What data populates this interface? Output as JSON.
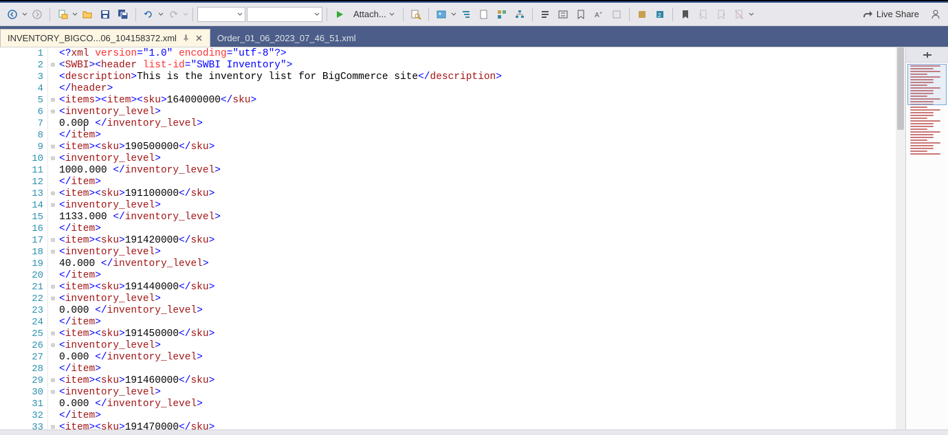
{
  "toolbar": {
    "attach_label": "Attach...",
    "liveshare_label": "Live Share"
  },
  "tabs": [
    {
      "label": "INVENTORY_BIGCO...06_104158372.xml",
      "active": true
    },
    {
      "label": "Order_01_06_2023_07_46_51.xml",
      "active": false
    }
  ],
  "code_lines": [
    {
      "n": 1,
      "fold": "",
      "html": "<span class='t-punc'>&lt;?</span><span class='t-tag'>xml</span> <span class='t-attr'>version</span><span class='t-punc'>=</span><span class='t-str'>\"1.0\"</span> <span class='t-attr'>encoding</span><span class='t-punc'>=</span><span class='t-str'>\"utf-8\"</span><span class='t-punc'>?&gt;</span>"
    },
    {
      "n": 2,
      "fold": "⊟",
      "html": "<span class='t-punc'>&lt;</span><span class='t-tag'>SWBI</span><span class='t-punc'>&gt;&lt;</span><span class='t-tag'>header</span> <span class='t-attr'>list-id</span><span class='t-punc'>=</span><span class='t-str'>\"SWBI Inventory\"</span><span class='t-punc'>&gt;</span>"
    },
    {
      "n": 3,
      "fold": "",
      "html": "<span class='t-punc'>&lt;</span><span class='t-tag'>description</span><span class='t-punc'>&gt;</span><span class='t-text'>This is the inventory list for BigCommerce site</span><span class='t-punc'>&lt;/</span><span class='t-tag'>description</span><span class='t-punc'>&gt;</span>"
    },
    {
      "n": 4,
      "fold": "",
      "html": "<span class='t-punc'>&lt;/</span><span class='t-tag'>header</span><span class='t-punc'>&gt;</span>"
    },
    {
      "n": 5,
      "fold": "⊟",
      "html": "<span class='t-punc'>&lt;</span><span class='t-tag'>items</span><span class='t-punc'>&gt;&lt;</span><span class='t-tag'>item</span><span class='t-punc'>&gt;&lt;</span><span class='t-tag'>sku</span><span class='t-punc'>&gt;</span><span class='t-text'>164000000</span><span class='t-punc'>&lt;/</span><span class='t-tag'>sku</span><span class='t-punc'>&gt;</span>"
    },
    {
      "n": 6,
      "fold": "⊟",
      "html": "<span class='t-punc'>&lt;</span><span class='t-tag'>inventory_level</span><span class='t-punc'>&gt;</span>"
    },
    {
      "n": 7,
      "fold": "",
      "html": "<span class='t-text'>0.000 </span><span class='t-punc'>&lt;/</span><span class='t-tag'>inventory_level</span><span class='t-punc'>&gt;</span>"
    },
    {
      "n": 8,
      "fold": "",
      "html": "<span class='t-punc'>&lt;/</span><span class='t-tag'>item</span><span class='t-punc'>&gt;</span>"
    },
    {
      "n": 9,
      "fold": "⊟",
      "html": "<span class='t-punc'>&lt;</span><span class='t-tag'>item</span><span class='t-punc'>&gt;&lt;</span><span class='t-tag'>sku</span><span class='t-punc'>&gt;</span><span class='t-text'>190500000</span><span class='t-punc'>&lt;/</span><span class='t-tag'>sku</span><span class='t-punc'>&gt;</span>"
    },
    {
      "n": 10,
      "fold": "⊟",
      "html": "<span class='t-punc'>&lt;</span><span class='t-tag'>inventory_level</span><span class='t-punc'>&gt;</span>"
    },
    {
      "n": 11,
      "fold": "",
      "html": "<span class='t-text'>1000.000 </span><span class='t-punc'>&lt;/</span><span class='t-tag'>inventory_level</span><span class='t-punc'>&gt;</span>"
    },
    {
      "n": 12,
      "fold": "",
      "html": "<span class='t-punc'>&lt;/</span><span class='t-tag'>item</span><span class='t-punc'>&gt;</span>"
    },
    {
      "n": 13,
      "fold": "⊟",
      "html": "<span class='t-punc'>&lt;</span><span class='t-tag'>item</span><span class='t-punc'>&gt;&lt;</span><span class='t-tag'>sku</span><span class='t-punc'>&gt;</span><span class='t-text'>191100000</span><span class='t-punc'>&lt;/</span><span class='t-tag'>sku</span><span class='t-punc'>&gt;</span>"
    },
    {
      "n": 14,
      "fold": "⊟",
      "html": "<span class='t-punc'>&lt;</span><span class='t-tag'>inventory_level</span><span class='t-punc'>&gt;</span>"
    },
    {
      "n": 15,
      "fold": "",
      "html": "<span class='t-text'>1133.000 </span><span class='t-punc'>&lt;/</span><span class='t-tag'>inventory_level</span><span class='t-punc'>&gt;</span>"
    },
    {
      "n": 16,
      "fold": "",
      "html": "<span class='t-punc'>&lt;/</span><span class='t-tag'>item</span><span class='t-punc'>&gt;</span>"
    },
    {
      "n": 17,
      "fold": "⊟",
      "html": "<span class='t-punc'>&lt;</span><span class='t-tag'>item</span><span class='t-punc'>&gt;&lt;</span><span class='t-tag'>sku</span><span class='t-punc'>&gt;</span><span class='t-text'>191420000</span><span class='t-punc'>&lt;/</span><span class='t-tag'>sku</span><span class='t-punc'>&gt;</span>"
    },
    {
      "n": 18,
      "fold": "⊟",
      "html": "<span class='t-punc'>&lt;</span><span class='t-tag'>inventory_level</span><span class='t-punc'>&gt;</span>"
    },
    {
      "n": 19,
      "fold": "",
      "html": "<span class='t-text'>40.000 </span><span class='t-punc'>&lt;/</span><span class='t-tag'>inventory_level</span><span class='t-punc'>&gt;</span>"
    },
    {
      "n": 20,
      "fold": "",
      "html": "<span class='t-punc'>&lt;/</span><span class='t-tag'>item</span><span class='t-punc'>&gt;</span>"
    },
    {
      "n": 21,
      "fold": "⊟",
      "html": "<span class='t-punc'>&lt;</span><span class='t-tag'>item</span><span class='t-punc'>&gt;&lt;</span><span class='t-tag'>sku</span><span class='t-punc'>&gt;</span><span class='t-text'>191440000</span><span class='t-punc'>&lt;/</span><span class='t-tag'>sku</span><span class='t-punc'>&gt;</span>"
    },
    {
      "n": 22,
      "fold": "⊟",
      "html": "<span class='t-punc'>&lt;</span><span class='t-tag'>inventory_level</span><span class='t-punc'>&gt;</span>"
    },
    {
      "n": 23,
      "fold": "",
      "html": "<span class='t-text'>0.000 </span><span class='t-punc'>&lt;/</span><span class='t-tag'>inventory_level</span><span class='t-punc'>&gt;</span>"
    },
    {
      "n": 24,
      "fold": "",
      "html": "<span class='t-punc'>&lt;/</span><span class='t-tag'>item</span><span class='t-punc'>&gt;</span>"
    },
    {
      "n": 25,
      "fold": "⊟",
      "html": "<span class='t-punc'>&lt;</span><span class='t-tag'>item</span><span class='t-punc'>&gt;&lt;</span><span class='t-tag'>sku</span><span class='t-punc'>&gt;</span><span class='t-text'>191450000</span><span class='t-punc'>&lt;/</span><span class='t-tag'>sku</span><span class='t-punc'>&gt;</span>"
    },
    {
      "n": 26,
      "fold": "⊟",
      "html": "<span class='t-punc'>&lt;</span><span class='t-tag'>inventory_level</span><span class='t-punc'>&gt;</span>"
    },
    {
      "n": 27,
      "fold": "",
      "html": "<span class='t-text'>0.000 </span><span class='t-punc'>&lt;/</span><span class='t-tag'>inventory_level</span><span class='t-punc'>&gt;</span>"
    },
    {
      "n": 28,
      "fold": "",
      "html": "<span class='t-punc'>&lt;/</span><span class='t-tag'>item</span><span class='t-punc'>&gt;</span>"
    },
    {
      "n": 29,
      "fold": "⊟",
      "html": "<span class='t-punc'>&lt;</span><span class='t-tag'>item</span><span class='t-punc'>&gt;&lt;</span><span class='t-tag'>sku</span><span class='t-punc'>&gt;</span><span class='t-text'>191460000</span><span class='t-punc'>&lt;/</span><span class='t-tag'>sku</span><span class='t-punc'>&gt;</span>"
    },
    {
      "n": 30,
      "fold": "⊟",
      "html": "<span class='t-punc'>&lt;</span><span class='t-tag'>inventory_level</span><span class='t-punc'>&gt;</span>"
    },
    {
      "n": 31,
      "fold": "",
      "html": "<span class='t-text'>0.000 </span><span class='t-punc'>&lt;/</span><span class='t-tag'>inventory_level</span><span class='t-punc'>&gt;</span>"
    },
    {
      "n": 32,
      "fold": "",
      "html": "<span class='t-punc'>&lt;/</span><span class='t-tag'>item</span><span class='t-punc'>&gt;</span>"
    },
    {
      "n": 33,
      "fold": "⊟",
      "html": "<span class='t-punc'>&lt;</span><span class='t-tag'>item</span><span class='t-punc'>&gt;&lt;</span><span class='t-tag'>sku</span><span class='t-punc'>&gt;</span><span class='t-text'>191470000</span><span class='t-punc'>&lt;/</span><span class='t-tag'>sku</span><span class='t-punc'>&gt;</span>"
    }
  ]
}
